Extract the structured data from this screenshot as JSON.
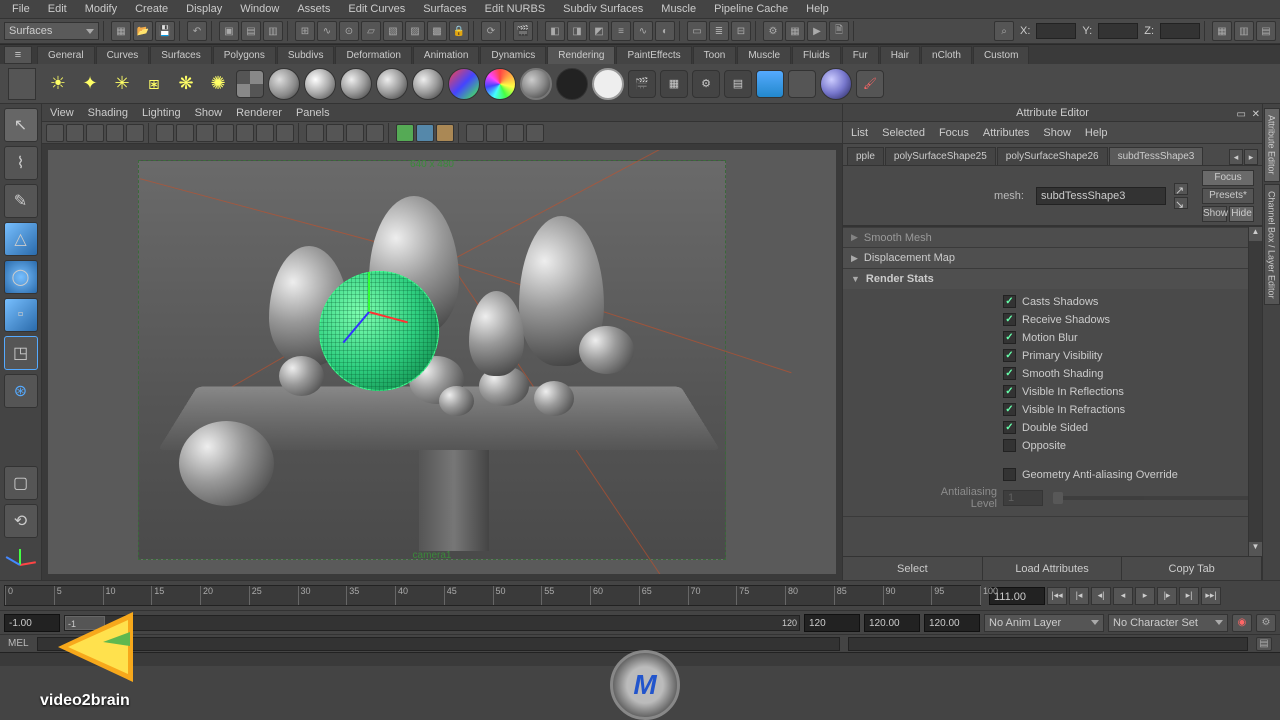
{
  "menubar": [
    "File",
    "Edit",
    "Modify",
    "Create",
    "Display",
    "Window",
    "Assets",
    "Edit Curves",
    "Surfaces",
    "Edit NURBS",
    "Subdiv Surfaces",
    "Muscle",
    "Pipeline Cache",
    "Help"
  ],
  "module_dropdown": "Surfaces",
  "xyz": {
    "x": "X:",
    "y": "Y:",
    "z": "Z:"
  },
  "shelf_tabs": [
    "General",
    "Curves",
    "Surfaces",
    "Polygons",
    "Subdivs",
    "Deformation",
    "Animation",
    "Dynamics",
    "Rendering",
    "PaintEffects",
    "Toon",
    "Muscle",
    "Fluids",
    "Fur",
    "Hair",
    "nCloth",
    "Custom"
  ],
  "shelf_active": "Rendering",
  "viewport_menu": [
    "View",
    "Shading",
    "Lighting",
    "Show",
    "Renderer",
    "Panels"
  ],
  "viewport": {
    "res_label": "640 x 480",
    "camera_label": "camera1"
  },
  "attr_editor": {
    "title": "Attribute Editor",
    "menu": [
      "List",
      "Selected",
      "Focus",
      "Attributes",
      "Show",
      "Help"
    ],
    "tabs": [
      "pple",
      "polySurfaceShape25",
      "polySurfaceShape26",
      "subdTessShape3"
    ],
    "active_tab": "subdTessShape3",
    "mesh_label": "mesh:",
    "mesh_value": "subdTessShape3",
    "side_buttons": {
      "focus": "Focus",
      "presets": "Presets*",
      "show": "Show",
      "hide": "Hide"
    },
    "sections": {
      "smooth": "Smooth Mesh",
      "disp": "Displacement Map",
      "render": "Render Stats"
    },
    "render_stats": [
      {
        "label": "Casts Shadows",
        "checked": true
      },
      {
        "label": "Receive Shadows",
        "checked": true
      },
      {
        "label": "Motion Blur",
        "checked": true
      },
      {
        "label": "Primary Visibility",
        "checked": true
      },
      {
        "label": "Smooth Shading",
        "checked": true
      },
      {
        "label": "Visible In Reflections",
        "checked": true
      },
      {
        "label": "Visible In Refractions",
        "checked": true
      },
      {
        "label": "Double Sided",
        "checked": true
      },
      {
        "label": "Opposite",
        "checked": false
      }
    ],
    "geom_aa": {
      "label": "Geometry Anti-aliasing Override",
      "checked": false
    },
    "aa_level": {
      "label": "Antialiasing Level",
      "value": "1"
    },
    "buttons": [
      "Select",
      "Load Attributes",
      "Copy Tab"
    ]
  },
  "right_tabs": [
    "Attribute Editor",
    "Channel Box / Layer Editor"
  ],
  "timeline": {
    "ticks": [
      0,
      5,
      10,
      15,
      20,
      25,
      30,
      35,
      40,
      45,
      50,
      55,
      60,
      65,
      70,
      75,
      80,
      85,
      90,
      95,
      100
    ],
    "current_frame": "111.00"
  },
  "range": {
    "start": "-1.00",
    "start2": "-1",
    "end": "120",
    "end2": "120",
    "field3": "120.00",
    "field4": "120.00",
    "anim_layer": "No Anim Layer",
    "char_set": "No Character Set"
  },
  "cmd": {
    "lang": "MEL"
  },
  "watermark": "video2brain"
}
